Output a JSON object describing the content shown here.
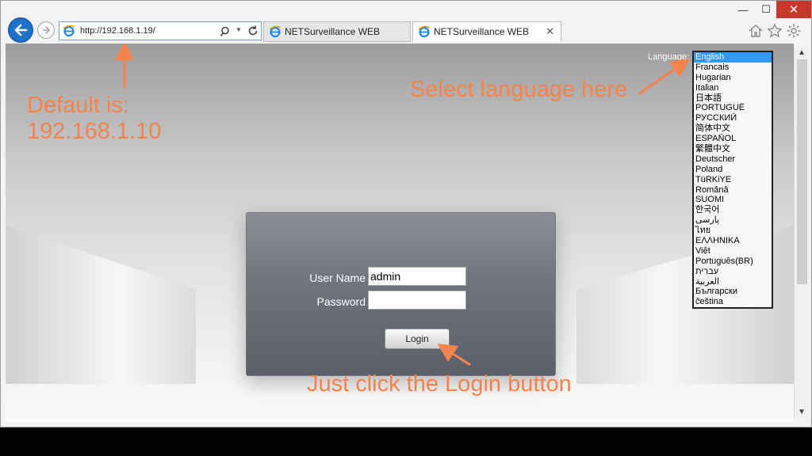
{
  "browser": {
    "url": "http://192.168.1.19/",
    "tabs": [
      {
        "label": "NETSurveillance WEB",
        "active": false
      },
      {
        "label": "NETSurveillance WEB",
        "active": true
      }
    ],
    "tab_close": "✕",
    "minimize": "—",
    "maximize": "☐",
    "close": "✕"
  },
  "login": {
    "username_label": "User Name",
    "username_value": "admin",
    "password_label": "Password",
    "password_value": "",
    "login_button": "Login"
  },
  "language": {
    "label": "Language:",
    "options": [
      "English",
      "Francais",
      "Hugarian",
      "Italian",
      "日本語",
      "PORTUGUÊ",
      "РУССКИЙ",
      "简体中文",
      "ESPAÑOL",
      "繁體中文",
      "Deutscher",
      "Poland",
      "TüRKiYE",
      "Română",
      "SUOMI",
      "한국어",
      "پارسی",
      "ไทย",
      "ΕΛΛΗΝΙΚΑ",
      "Việt",
      "Português(BR)",
      "עברית",
      "العربية",
      "Български",
      "čeština"
    ],
    "selected_index": 0
  },
  "annotations": {
    "default_ip": "Default is:\n192.168.1.10",
    "select_language": "Select language here",
    "login_hint": "Just click the Login button"
  },
  "colors": {
    "annotation": "#f5834d",
    "selection": "#3399ff",
    "close_button": "#c7382b"
  }
}
